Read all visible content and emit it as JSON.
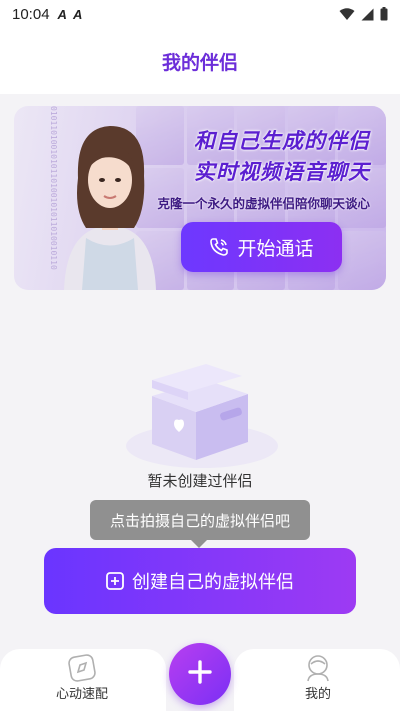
{
  "status_bar": {
    "time": "10:04",
    "notif_icons": [
      "A",
      "A"
    ],
    "wifi": "wifi-icon",
    "signal": "signal-icon",
    "battery": "battery-icon"
  },
  "header": {
    "title": "我的伴侣"
  },
  "banner": {
    "headline_1": "和自己生成的伴侣",
    "headline_2": "实时视频语音聊天",
    "subtitle": "克隆一个永久的虚拟伴侣陪你聊天谈心",
    "button_label": "开始通话",
    "binary_text": "0101101001010110100101011010010110"
  },
  "empty_state": {
    "message": "暂未创建过伴侣",
    "tooltip": "点击拍摄自己的虚拟伴侣吧",
    "create_button": "创建自己的虚拟伴侣"
  },
  "bottom_nav": {
    "items": [
      {
        "label": "心动速配",
        "icon": "compass-icon"
      },
      {
        "label": "",
        "icon": "plus-icon"
      },
      {
        "label": "我的",
        "icon": "profile-icon"
      }
    ]
  },
  "colors": {
    "accent": "#6c2ed9",
    "button_start": "#6a35ff",
    "button_end": "#9d3af3",
    "tooltip_bg": "#909090",
    "page_bg": "#f4f3f6"
  }
}
